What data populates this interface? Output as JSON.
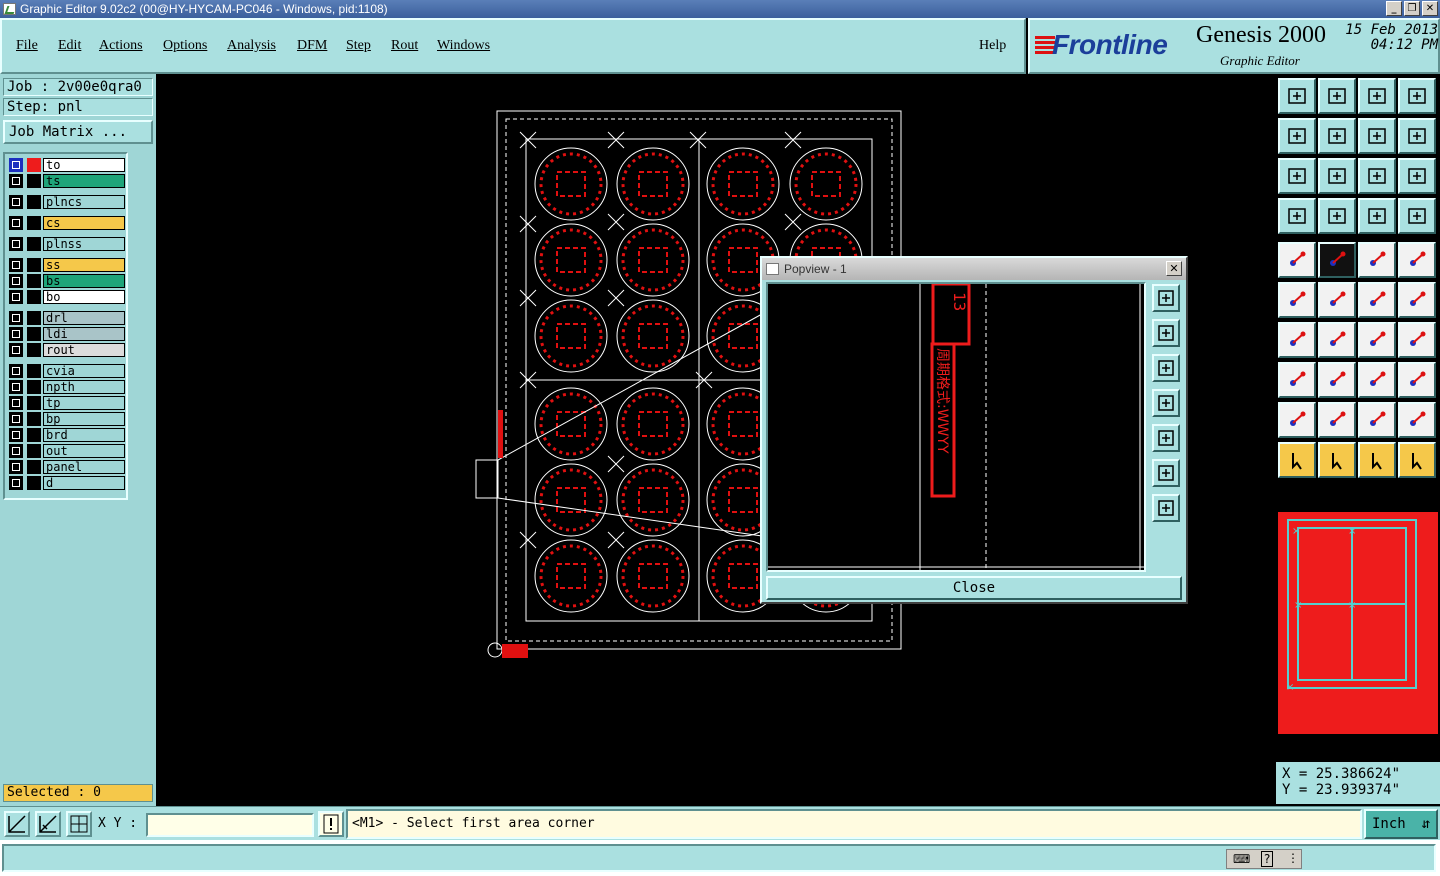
{
  "window": {
    "title": "Graphic Editor 9.02c2 (00@HY-HYCAM-PC046 - Windows, pid:1108)",
    "buttons": [
      "_",
      "❐",
      "✕"
    ]
  },
  "menu": {
    "items": [
      "File",
      "Edit",
      "Actions",
      "Options",
      "Analysis",
      "DFM",
      "Step",
      "Rout",
      "Windows"
    ],
    "help": "Help"
  },
  "brand": {
    "logo": "Frontline",
    "product": "Genesis 2000",
    "subtitle": "Graphic Editor",
    "date": "15 Feb 2013",
    "time": "04:12 PM"
  },
  "job": {
    "job_label": "Job : 2v00e0qra0",
    "step_label": "Step: pnl",
    "matrix_button": "Job Matrix ..."
  },
  "layers": [
    {
      "name": "to",
      "color": "#ffffff",
      "mark": "#ee1c1c",
      "active": true
    },
    {
      "name": "ts",
      "color": "#1fa57a"
    },
    {
      "name": "plncs",
      "color": "#9fd6d6"
    },
    {
      "name": "cs",
      "color": "#f5c84a"
    },
    {
      "name": "plnss",
      "color": "#9fd6d6"
    },
    {
      "name": "ss",
      "color": "#f5c84a"
    },
    {
      "name": "bs",
      "color": "#1fa57a"
    },
    {
      "name": "bo",
      "color": "#ffffff"
    },
    {
      "name": "drl",
      "color": "#a9c4c8"
    },
    {
      "name": "ldi",
      "color": "#a9c4c8"
    },
    {
      "name": "rout",
      "color": "#dcdcdc"
    },
    {
      "name": "cvia",
      "color": "#9fd6d6"
    },
    {
      "name": "npth",
      "color": "#9fd6d6"
    },
    {
      "name": "tp",
      "color": "#9fd6d6"
    },
    {
      "name": "bp",
      "color": "#9fd6d6"
    },
    {
      "name": "brd",
      "color": "#9fd6d6"
    },
    {
      "name": "out",
      "color": "#9fd6d6"
    },
    {
      "name": "panel",
      "color": "#9fd6d6"
    },
    {
      "name": "d",
      "color": "#9fd6d6"
    }
  ],
  "status": {
    "selected": "Selected : 0",
    "xy_label": "X Y :",
    "xy_value": "",
    "message": "<M1> - Select first area corner",
    "unit": "Inch",
    "x": "X = 25.386624\"",
    "y": "Y = 23.939374\""
  },
  "popview": {
    "title": "Popview - 1",
    "close_label": "Close",
    "callout_text": "13",
    "vertical_text": "周期格式:WWYY"
  },
  "colors": {
    "accent": "#aae0e0",
    "layer_red": "#ee1c1c",
    "highlight_yellow": "#f5c84a",
    "brand_blue": "#1b3e9a"
  }
}
